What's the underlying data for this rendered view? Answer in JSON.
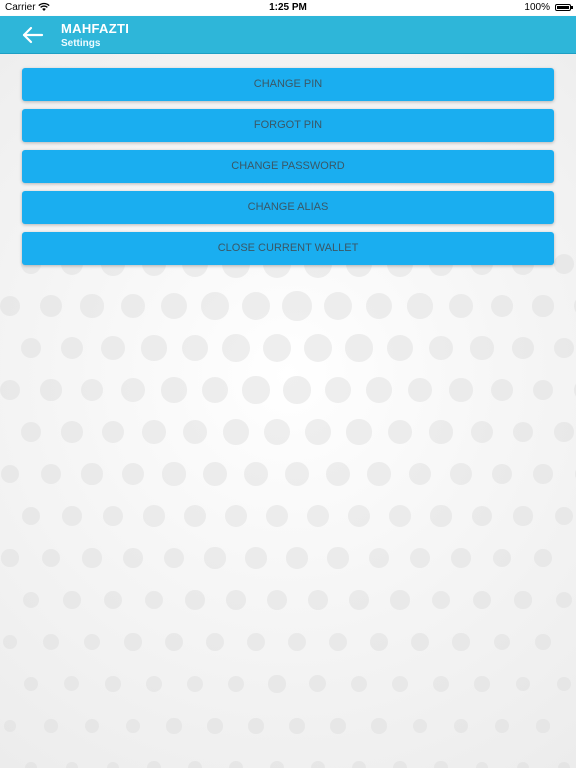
{
  "status_bar": {
    "carrier": "Carrier",
    "time": "1:25 PM",
    "battery": "100%",
    "wifi_icon": "wifi-icon",
    "battery_icon": "battery-icon"
  },
  "app_bar": {
    "title": "MAHFAZTI",
    "subtitle": "Settings",
    "back_icon": "back-arrow-icon",
    "color": "#2eb6d9"
  },
  "menu": {
    "button_color": "#1aaef0",
    "items": [
      {
        "label": "CHANGE PIN"
      },
      {
        "label": "FORGOT PIN"
      },
      {
        "label": "CHANGE PASSWORD"
      },
      {
        "label": "CHANGE ALIAS"
      },
      {
        "label": "CLOSE CURRENT WALLET"
      }
    ]
  }
}
